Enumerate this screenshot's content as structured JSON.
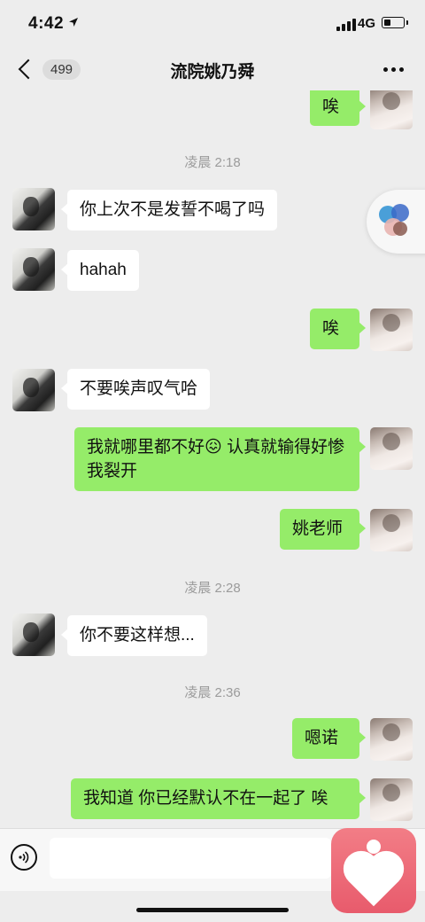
{
  "status_bar": {
    "time": "4:42",
    "network": "4G",
    "battery_level": 0.35
  },
  "nav": {
    "unread_count": "499",
    "title": "流院姚乃舜",
    "more": "..."
  },
  "messages": [
    {
      "type": "out",
      "text": "唉"
    },
    {
      "type": "time",
      "text": "凌晨 2:18"
    },
    {
      "type": "in",
      "text": "你上次不是发誓不喝了吗"
    },
    {
      "type": "in",
      "text": "hahah"
    },
    {
      "type": "out",
      "text": "唉"
    },
    {
      "type": "in",
      "text": "不要唉声叹气哈"
    },
    {
      "type": "out",
      "text": "我就哪里都不好😖 认真就输得好惨 我裂开"
    },
    {
      "type": "out",
      "text": "姚老师"
    },
    {
      "type": "time",
      "text": "凌晨 2:28"
    },
    {
      "type": "in",
      "text": "你不要这样想..."
    },
    {
      "type": "time",
      "text": "凌晨 2:36"
    },
    {
      "type": "out",
      "text": "嗯诺"
    },
    {
      "type": "out",
      "text": "我知道 你已经默认不在一起了 唉"
    }
  ],
  "input": {
    "placeholder": ""
  },
  "icons": {
    "voice": "voice-icon",
    "float": "floating-window-icon",
    "app": "heart-app-icon"
  },
  "colors": {
    "out_bubble": "#95ec69",
    "in_bubble": "#ffffff",
    "background": "#ededed"
  }
}
